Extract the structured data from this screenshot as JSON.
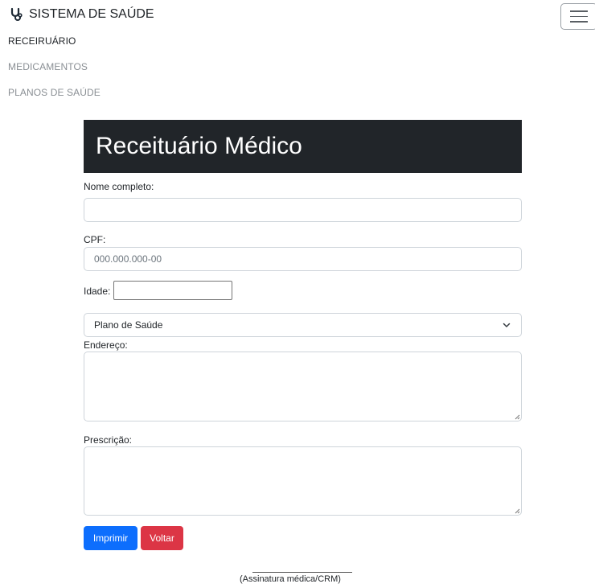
{
  "navbar": {
    "brand": "SISTEMA DE SAÚDE",
    "brand_icon": "stethoscope-icon",
    "links": [
      {
        "label": "RECEIRUÁRIO",
        "active": true
      },
      {
        "label": "MEDICAMENTOS",
        "active": false
      },
      {
        "label": "PLANOS DE SAÚDE",
        "active": false
      }
    ],
    "toggler_icon": "hamburger-menu-icon"
  },
  "form": {
    "title": "Receituário Médico",
    "nome_label": "Nome completo:",
    "nome_value": "",
    "cpf_label": "CPF:",
    "cpf_placeholder": "000.000.000-00",
    "idade_label": "Idade:",
    "idade_value": "",
    "plano_selected": "Plano de Saúde",
    "endereco_label": "Endereço:",
    "prescricao_label": "Prescrição:",
    "print_button": "Imprimir",
    "back_button": "Voltar",
    "signature": "(Assinatura médica/CRM)"
  },
  "colors": {
    "header_bg": "#212529",
    "primary": "#0d6efd",
    "danger": "#dc3545"
  }
}
